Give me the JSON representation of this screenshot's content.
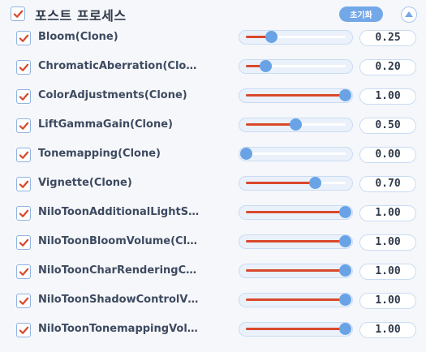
{
  "header": {
    "title": "포스트 프로세스",
    "reset_label": "초기화",
    "checked": true
  },
  "colors": {
    "accent": "#72a8e8",
    "fill": "#d9482b",
    "check": "#d9482b"
  },
  "rows": [
    {
      "label": "Bloom(Clone)",
      "value": "0.25",
      "level": 0.25
    },
    {
      "label": "ChromaticAberration(Clo…",
      "value": "0.20",
      "level": 0.2
    },
    {
      "label": "ColorAdjustments(Clone)",
      "value": "1.00",
      "level": 1.0
    },
    {
      "label": "LiftGammaGain(Clone)",
      "value": "0.50",
      "level": 0.5
    },
    {
      "label": "Tonemapping(Clone)",
      "value": "0.00",
      "level": 0.0
    },
    {
      "label": "Vignette(Clone)",
      "value": "0.70",
      "level": 0.7
    },
    {
      "label": "NiloToonAdditionalLightS…",
      "value": "1.00",
      "level": 1.0
    },
    {
      "label": "NiloToonBloomVolume(Cl…",
      "value": "1.00",
      "level": 1.0
    },
    {
      "label": "NiloToonCharRenderingC…",
      "value": "1.00",
      "level": 1.0
    },
    {
      "label": "NiloToonShadowControlV…",
      "value": "1.00",
      "level": 1.0
    },
    {
      "label": "NiloToonTonemappingVol…",
      "value": "1.00",
      "level": 1.0
    }
  ]
}
